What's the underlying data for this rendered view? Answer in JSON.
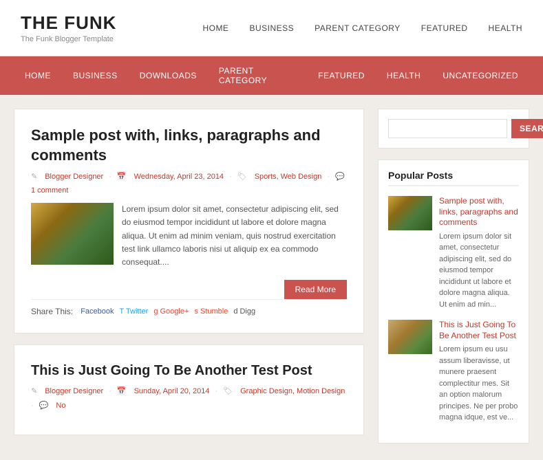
{
  "site": {
    "title": "THE FUNK",
    "tagline": "The Funk Blogger Template"
  },
  "top_nav": {
    "items": [
      {
        "label": "HOME"
      },
      {
        "label": "BUSINESS"
      },
      {
        "label": "PARENT CATEGORY"
      },
      {
        "label": "FEATURED"
      },
      {
        "label": "HEALTH"
      }
    ]
  },
  "main_nav": {
    "items": [
      {
        "label": "HOME"
      },
      {
        "label": "BUSINESS"
      },
      {
        "label": "DOWNLOADS"
      },
      {
        "label": "PARENT CATEGORY"
      },
      {
        "label": "FEATURED"
      },
      {
        "label": "HEALTH"
      },
      {
        "label": "UNCATEGORIZED"
      }
    ]
  },
  "posts": [
    {
      "title": "Sample post with, links, paragraphs and comments",
      "author": "Blogger Designer",
      "date": "Wednesday, April 23, 2014",
      "categories": "Sports, Web Design",
      "comments": "1 comment",
      "excerpt": "Lorem ipsum dolor sit amet, consectetur adipiscing elit, sed do eiusmod tempor incididunt ut labore et dolore magna aliqua. Ut enim ad minim veniam, quis nostrud exercitation test link ullamco laboris nisi ut aliquip ex ea commodo consequat....",
      "read_more": "Read More",
      "share_label": "Share This:",
      "share_items": [
        {
          "label": "Facebook",
          "icon": "f"
        },
        {
          "label": "Twitter",
          "icon": "t"
        },
        {
          "label": "Google+",
          "icon": "g"
        },
        {
          "label": "Stumble",
          "icon": "s"
        },
        {
          "label": "Digg",
          "icon": "d"
        }
      ]
    },
    {
      "title": "This is Just Going To Be Another Test Post",
      "author": "Blogger Designer",
      "date": "Sunday, April 20, 2014",
      "categories": "Graphic Design, Motion Design",
      "comments": "No"
    }
  ],
  "sidebar": {
    "search_placeholder": "",
    "search_btn": "SEARCH",
    "popular_posts_title": "Popular Posts",
    "popular_posts": [
      {
        "title": "Sample post with, links, paragraphs and comments",
        "excerpt": "Lorem ipsum dolor sit amet, consectetur adipiscing elit, sed do eiusmod tempor incididunt ut labore et dolore magna aliqua. Ut enim ad min..."
      },
      {
        "title": "This is Just Going To Be Another Test Post",
        "excerpt": "Lorem ipsum eu usu assum liberavisse, ut munere praesent complectitur mes. Sit an option malorum principes. Ne per probo magna idque, est ve..."
      }
    ]
  }
}
